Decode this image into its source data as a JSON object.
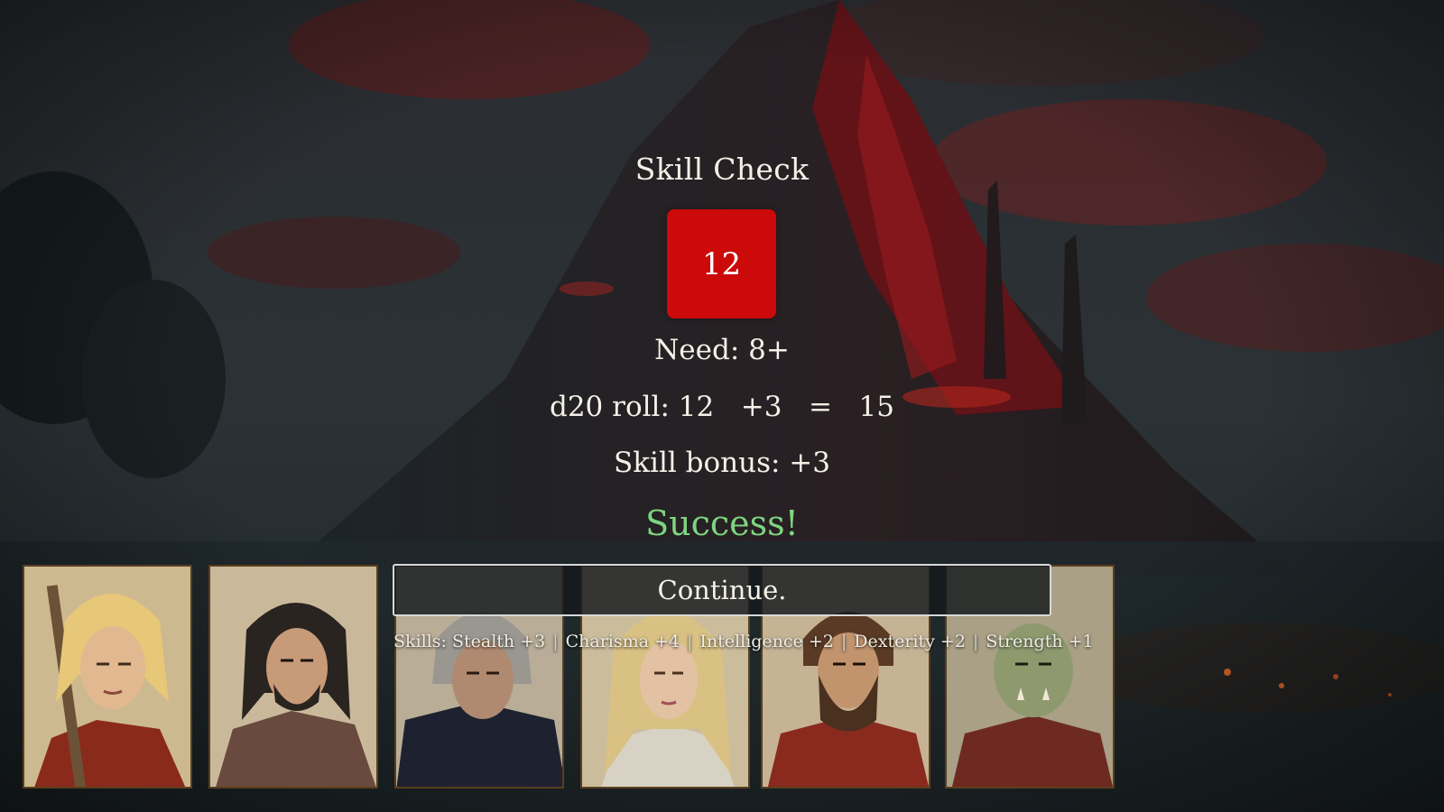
{
  "check": {
    "title": "Skill Check",
    "die_value": "12",
    "need": "Need: 8+",
    "roll": "d20 roll: 12   +3   =   15",
    "bonus": "Skill bonus: +3",
    "result": "Success!"
  },
  "continue_label": "Continue.",
  "skills": {
    "prefix": "Skills:",
    "items": [
      "Stealth +3",
      "Charisma +4",
      "Intelligence +2",
      "Dexterity +2",
      "Strength +1"
    ],
    "separator": "|"
  },
  "party": [
    {
      "name": "blonde-swordsman-portrait"
    },
    {
      "name": "dark-haired-ranger-portrait"
    },
    {
      "name": "old-wizard-portrait"
    },
    {
      "name": "blonde-woman-portrait"
    },
    {
      "name": "bearded-warrior-portrait"
    },
    {
      "name": "orc-portrait"
    }
  ],
  "colors": {
    "die": "#cc0a0a",
    "success": "#7fd47f",
    "portrait_border": "#5a3e1e"
  }
}
